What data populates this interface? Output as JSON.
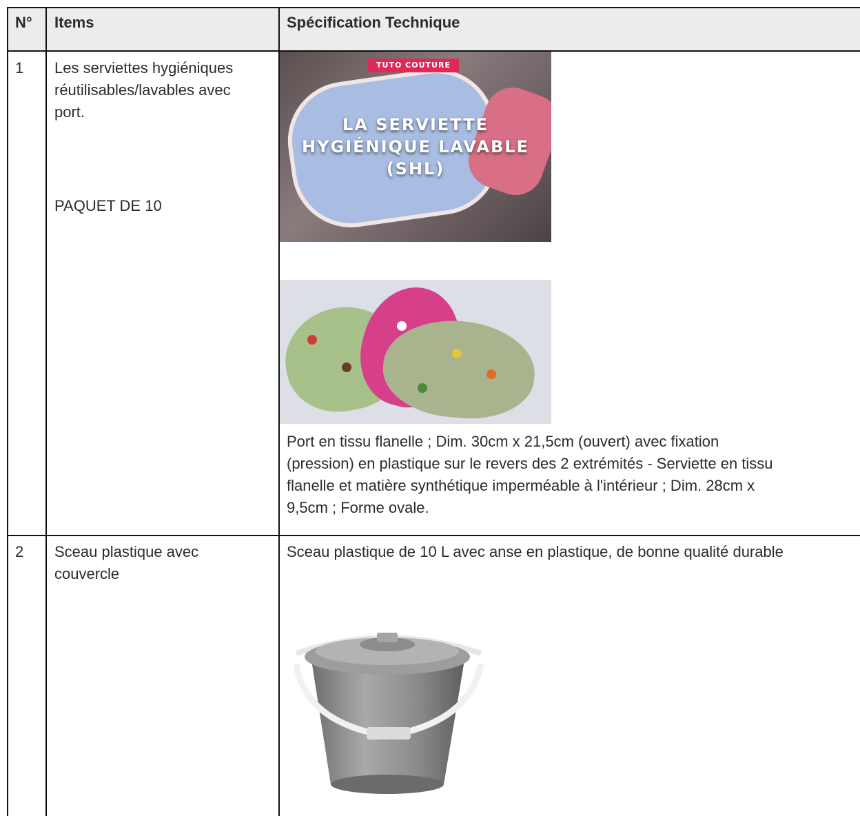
{
  "table": {
    "headers": [
      "N°",
      "Items",
      "Spécification Technique"
    ],
    "rows": [
      {
        "number": "1",
        "item_lines": [
          "Les serviettes hygiéniques",
          "réutilisables/lavables avec",
          "port."
        ],
        "item_note": "PAQUET DE 10",
        "image1_tag": "TUTO COUTURE",
        "image1_title_lines": [
          "LA SERVIETTE",
          "HYGIÉNIQUE LAVABLE",
          "(SHL)"
        ],
        "spec_lines": [
          "Port en tissu flanelle ; Dim. 30cm x 21,5cm (ouvert) avec fixation",
          "(pression) en plastique sur le revers des 2 extrémités - Serviette en tissu",
          "flanelle et matière synthétique imperméable à l'intérieur ; Dim. 28cm x",
          "9,5cm ; Forme ovale."
        ]
      },
      {
        "number": "2",
        "item_lines": [
          "Sceau plastique avec",
          "couvercle"
        ],
        "spec_lines": [
          "Sceau plastique de 10 L avec anse en plastique, de bonne qualité durable"
        ]
      }
    ]
  },
  "colors": {
    "header_bg": "#ececec",
    "grid": "#111111",
    "text": "#2b2b2b",
    "bucket": "#8f8f8f"
  }
}
